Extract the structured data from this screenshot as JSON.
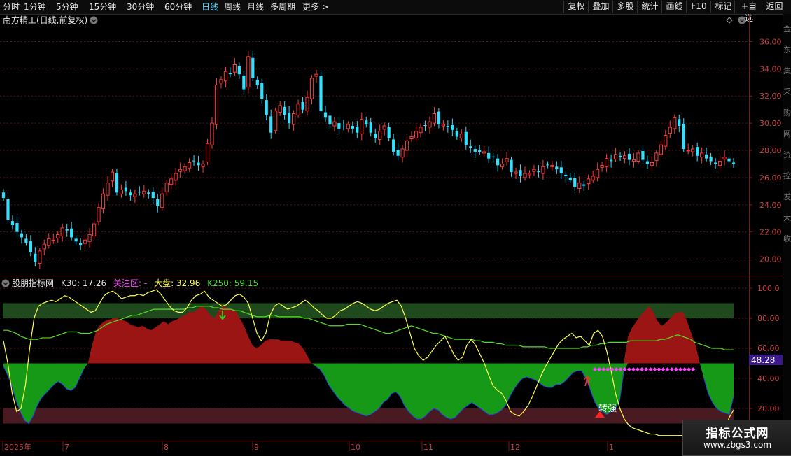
{
  "toolbar": {
    "periods": [
      "分时",
      "1分钟",
      "5分钟",
      "15分钟",
      "30分钟",
      "60分钟",
      "日线",
      "周线",
      "月线",
      "多周期",
      "更多 >"
    ],
    "active": "日线",
    "right_buttons": [
      "复权",
      "叠加",
      "多股",
      "统计",
      "画线",
      "F10",
      "标记",
      "+自选",
      "返回"
    ]
  },
  "main": {
    "title": "南方精工(日线,前复权)",
    "y_ticks": [
      "36.00",
      "34.00",
      "32.00",
      "30.00",
      "28.00",
      "26.00",
      "24.00",
      "22.00",
      "20.00"
    ]
  },
  "indicator": {
    "name": "股朋指标网",
    "k30": "K30: 17.26",
    "focus": "关注区: -",
    "dapan": "大盘: 32.96",
    "k250": "K250: 59.15",
    "value_tag": "48.28",
    "signal_text": "转强",
    "y_ticks": [
      "100.0",
      "80.00",
      "60.00",
      "40.00",
      "20.00"
    ]
  },
  "time_axis": {
    "labels": [
      "2025年",
      "7",
      "8",
      "9",
      "10",
      "11",
      "12",
      "1"
    ]
  },
  "side_text": "金\n东\n集\n采\n购\n网\n资\n控\n发\n大\n收",
  "watermark": {
    "line1": "指标公式网",
    "line2": "www.zbgs3.com"
  },
  "colors": {
    "up": "#ff3b3b",
    "down": "#33e0ff",
    "active_tab": "#4fd3ff",
    "red_area": "#9c1515",
    "green_area": "#169916",
    "k30_line": "#ffff55",
    "k250_line": "#55dd22"
  },
  "chart_data": [
    {
      "type": "candlestick",
      "title": "南方精工(日线,前复权)",
      "x_labels": [
        "2025年",
        "7",
        "8",
        "9",
        "10",
        "11",
        "12",
        "1"
      ],
      "ylim": [
        19.0,
        37.0
      ],
      "close": [
        24.5,
        22.9,
        22.5,
        22.0,
        21.6,
        21.2,
        20.5,
        19.8,
        20.6,
        21.1,
        21.5,
        21.4,
        21.8,
        22.3,
        22.1,
        21.6,
        21.3,
        21.0,
        21.4,
        21.8,
        22.6,
        23.8,
        24.8,
        25.6,
        26.4,
        24.9,
        25.1,
        25.0,
        24.7,
        24.8,
        24.9,
        25.0,
        24.8,
        24.5,
        23.9,
        24.8,
        25.6,
        25.9,
        26.3,
        26.6,
        26.8,
        27.1,
        27.2,
        26.9,
        27.0,
        28.5,
        30.0,
        32.8,
        33.2,
        33.8,
        33.6,
        34.3,
        33.6,
        32.5,
        34.9,
        33.3,
        32.8,
        31.8,
        30.6,
        29.3,
        30.9,
        31.3,
        30.6,
        30.0,
        30.7,
        31.4,
        31.0,
        31.9,
        33.3,
        33.6,
        30.9,
        30.4,
        29.9,
        30.1,
        29.6,
        29.7,
        29.9,
        29.6,
        29.3,
        30.3,
        29.9,
        29.3,
        28.9,
        29.4,
        29.8,
        28.9,
        27.9,
        27.6,
        28.1,
        28.7,
        29.0,
        29.4,
        29.7,
        29.8,
        30.1,
        30.7,
        29.9,
        29.9,
        29.7,
        29.5,
        29.0,
        29.2,
        28.4,
        28.2,
        27.9,
        27.9,
        27.9,
        27.4,
        27.5,
        26.9,
        27.0,
        27.4,
        26.4,
        26.4,
        26.1,
        26.3,
        26.3,
        26.6,
        26.4,
        26.8,
        26.9,
        26.9,
        26.6,
        26.3,
        26.1,
        25.8,
        25.3,
        25.6,
        25.4,
        25.9,
        26.1,
        26.6,
        26.9,
        27.4,
        27.2,
        27.7,
        27.5,
        27.6,
        27.3,
        27.3,
        27.8,
        27.3,
        27.0,
        27.1,
        27.8,
        28.4,
        29.1,
        29.7,
        30.4,
        29.8,
        28.1,
        28.0,
        28.1,
        27.6,
        27.8,
        27.4,
        27.2,
        27.0,
        27.2,
        27.5,
        27.2,
        27.0
      ]
    },
    {
      "type": "line",
      "title": "股朋指标网",
      "ylim": [
        0,
        100
      ],
      "series": [
        {
          "name": "K30",
          "values": [
            65,
            50,
            30,
            18,
            20,
            35,
            60,
            80,
            88,
            90,
            91,
            92,
            91,
            93,
            95,
            94,
            92,
            90,
            88,
            86,
            84,
            85,
            90,
            95,
            97,
            98,
            96,
            93,
            94,
            95,
            95,
            96,
            95,
            97,
            98,
            99,
            96,
            92,
            88,
            85,
            84,
            84,
            87,
            92,
            95,
            96,
            98,
            94,
            92,
            90,
            88,
            89,
            92,
            95,
            96,
            94,
            90,
            80,
            70,
            65,
            70,
            82,
            88,
            90,
            88,
            86,
            87,
            88,
            90,
            92,
            90,
            87,
            85,
            82,
            80,
            80,
            82,
            85,
            86,
            88,
            90,
            91,
            90,
            88,
            86,
            85,
            86,
            88,
            90,
            91,
            92,
            88,
            80,
            70,
            60,
            55,
            52,
            54,
            58,
            62,
            65,
            68,
            62,
            56,
            52,
            54,
            62,
            66,
            62,
            56,
            50,
            42,
            35,
            32,
            30,
            25,
            18,
            16,
            15,
            18,
            22,
            28,
            35,
            42,
            48,
            53,
            58,
            63,
            66,
            68,
            70,
            67,
            68,
            65,
            62,
            70,
            72,
            68,
            58,
            45,
            30,
            20,
            13,
            9,
            7,
            6,
            5,
            4,
            3,
            3,
            2,
            2,
            2,
            2,
            2,
            2,
            2,
            2,
            2,
            2,
            2,
            3,
            4,
            4,
            4,
            6,
            14,
            19
          ]
        },
        {
          "name": "K250",
          "values": [
            72,
            72,
            71,
            70,
            68,
            67,
            66,
            66,
            66,
            67,
            67,
            67,
            68,
            69,
            70,
            71,
            71,
            71,
            70,
            70,
            70,
            71,
            72,
            74,
            76,
            77,
            78,
            79,
            80,
            81,
            82,
            82,
            83,
            84,
            85,
            86,
            86,
            86,
            86,
            86,
            86,
            86,
            86,
            87,
            87,
            88,
            88,
            88,
            88,
            87,
            87,
            86,
            86,
            86,
            85,
            85,
            84,
            83,
            82,
            81,
            81,
            81,
            82,
            82,
            81,
            81,
            81,
            81,
            81,
            81,
            80,
            80,
            79,
            78,
            77,
            76,
            75,
            75,
            75,
            75,
            76,
            76,
            76,
            76,
            75,
            74,
            73,
            72,
            71,
            70,
            70,
            71,
            72,
            73,
            74,
            75,
            74,
            73,
            72,
            71,
            70,
            70,
            69,
            68,
            67,
            66,
            66,
            66,
            66,
            66,
            65,
            65,
            64,
            64,
            64,
            63,
            63,
            62,
            62,
            62,
            62,
            61,
            61,
            61,
            61,
            61,
            61,
            60,
            60,
            60,
            60,
            60,
            60,
            60,
            60,
            61,
            61,
            62,
            62,
            63,
            63,
            64,
            64,
            64,
            64,
            64,
            65,
            65,
            65,
            65,
            65,
            65,
            65,
            66,
            66,
            67,
            68,
            69,
            68,
            67,
            66,
            64,
            63,
            62,
            61,
            60,
            60,
            60,
            59,
            59,
            59
          ]
        },
        {
          "name": "关注区",
          "values": [
            48,
            42,
            35,
            25,
            18,
            12,
            10,
            15,
            22,
            27,
            30,
            33,
            36,
            38,
            36,
            33,
            32,
            34,
            40,
            46,
            50,
            62,
            72,
            76,
            78,
            79,
            80,
            80,
            79,
            78,
            76,
            75,
            74,
            75,
            73,
            72,
            74,
            76,
            78,
            76,
            78,
            79,
            81,
            82,
            84,
            84,
            86,
            88,
            86,
            82,
            80,
            85,
            88,
            87,
            86,
            85,
            80,
            75,
            68,
            62,
            60,
            62,
            65,
            66,
            66,
            66,
            65,
            65,
            65,
            64,
            63,
            60,
            55,
            50,
            48,
            46,
            42,
            36,
            32,
            28,
            25,
            22,
            20,
            18,
            17,
            16,
            15,
            16,
            18,
            20,
            24,
            26,
            30,
            31,
            28,
            22,
            18,
            15,
            13,
            13,
            15,
            18,
            20,
            19,
            16,
            14,
            13,
            14,
            17,
            20,
            22,
            24,
            22,
            20,
            18,
            16,
            16,
            17,
            19,
            22,
            28,
            33,
            37,
            40,
            41,
            40,
            39,
            37,
            35,
            34,
            34,
            36,
            36,
            38,
            41,
            44,
            45,
            45,
            40,
            33,
            25,
            20,
            18,
            16,
            18,
            20,
            25,
            45,
            68,
            74,
            78,
            82,
            85,
            88,
            84,
            78,
            75,
            77,
            80,
            83,
            84,
            84,
            78,
            70,
            62,
            50,
            40,
            30,
            24,
            20,
            18,
            17,
            16,
            28
          ]
        }
      ]
    }
  ]
}
